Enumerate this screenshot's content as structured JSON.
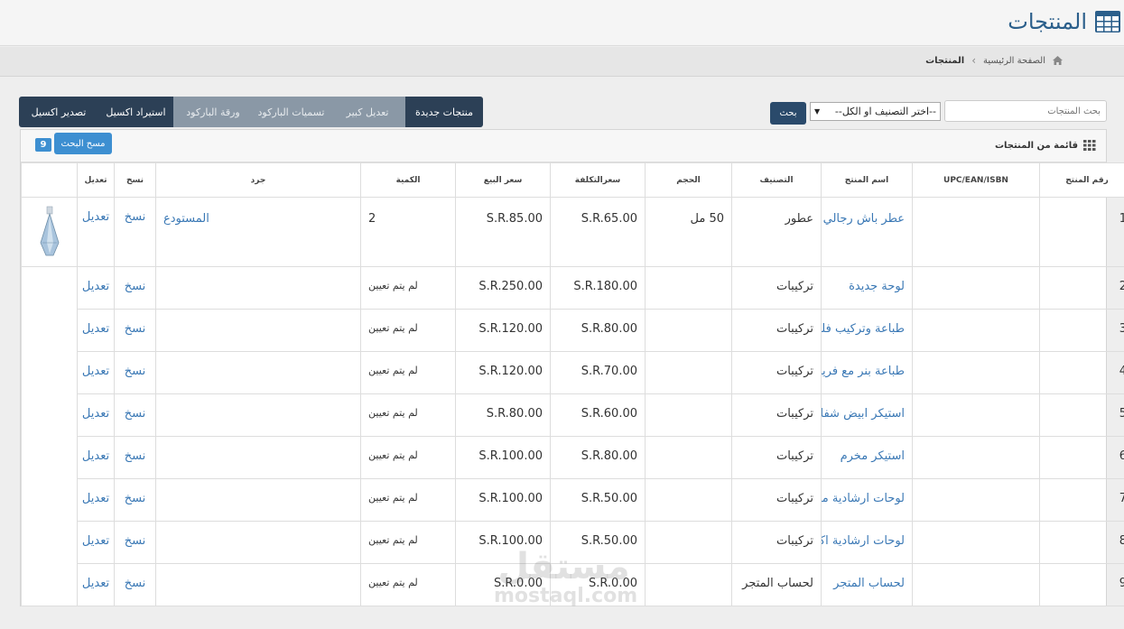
{
  "header": {
    "title": "المنتجات"
  },
  "breadcrumb": {
    "home": "الصفحة الرئيسية",
    "current": "المنتجات"
  },
  "search": {
    "placeholder": "بحث المنتجات",
    "category_selected": "--اختر التصنيف او الكل--",
    "button": "بحث"
  },
  "toolbar": {
    "new_products": "منتجات جديدة",
    "bulk_edit": "تعديل كبير",
    "barcode_labels": "تسميات الباركود",
    "barcode_sheet": "ورقة الباركود",
    "import_excel": "استيراد اكسيل",
    "export_excel": "تصدير اكسيل"
  },
  "panel": {
    "title": "قائمة من المنتجات",
    "clear_search": "مسح البحث",
    "count": "9"
  },
  "columns": {
    "number": "رقم المنتج",
    "upc": "UPC/EAN/ISBN",
    "name": "اسم المنتج",
    "category": "التصنيف",
    "size": "الحجم",
    "cost": "سعرالتكلفة",
    "price": "سعر البيع",
    "quantity": "الكمية",
    "inventory": "جرد",
    "copy": "نسخ",
    "edit": "تعديل"
  },
  "rows": [
    {
      "num": "1",
      "name": "عطر باش رجالي",
      "category": "عطور",
      "size": "50 مل",
      "cost": "S.R.65.00",
      "price": "S.R.85.00",
      "qty": "2",
      "inventory": "المستودع",
      "copy": "نسخ",
      "edit": "تعديل"
    },
    {
      "num": "2",
      "name": "لوحة جديدة",
      "category": "تركيبات",
      "size": "",
      "cost": "S.R.180.00",
      "price": "S.R.250.00",
      "qty": "لم يتم تعيين",
      "inventory": "",
      "copy": "نسخ",
      "edit": "تعديل"
    },
    {
      "num": "3",
      "name": "طباعة وتركيب فليكس",
      "category": "تركيبات",
      "size": "",
      "cost": "S.R.80.00",
      "price": "S.R.120.00",
      "qty": "لم يتم تعيين",
      "inventory": "",
      "copy": "نسخ",
      "edit": "تعديل"
    },
    {
      "num": "4",
      "name": "طباعة بنر مع فريم حديد",
      "category": "تركيبات",
      "size": "",
      "cost": "S.R.70.00",
      "price": "S.R.120.00",
      "qty": "لم يتم تعيين",
      "inventory": "",
      "copy": "نسخ",
      "edit": "تعديل"
    },
    {
      "num": "5",
      "name": "استيكر ابيض شفاف",
      "category": "تركيبات",
      "size": "",
      "cost": "S.R.60.00",
      "price": "S.R.80.00",
      "qty": "لم يتم تعيين",
      "inventory": "",
      "copy": "نسخ",
      "edit": "تعديل"
    },
    {
      "num": "6",
      "name": "استيكر مخرم",
      "category": "تركيبات",
      "size": "",
      "cost": "S.R.80.00",
      "price": "S.R.100.00",
      "qty": "لم يتم تعيين",
      "inventory": "",
      "copy": "نسخ",
      "edit": "تعديل"
    },
    {
      "num": "7",
      "name": "لوحات ارشادية مكتبية",
      "category": "تركيبات",
      "size": "",
      "cost": "S.R.50.00",
      "price": "S.R.100.00",
      "qty": "لم يتم تعيين",
      "inventory": "",
      "copy": "نسخ",
      "edit": "تعديل"
    },
    {
      "num": "8",
      "name": "لوحات ارشادية اكريليك",
      "category": "تركيبات",
      "size": "",
      "cost": "S.R.50.00",
      "price": "S.R.100.00",
      "qty": "لم يتم تعيين",
      "inventory": "",
      "copy": "نسخ",
      "edit": "تعديل"
    },
    {
      "num": "9",
      "name": "لحساب المتجر",
      "category": "لحساب المتجر",
      "size": "",
      "cost": "S.R.0.00",
      "price": "S.R.0.00",
      "qty": "لم يتم تعيين",
      "inventory": "",
      "copy": "نسخ",
      "edit": "تعديل"
    }
  ],
  "watermark": {
    "arabic": "مستقل",
    "latin": "mostaql.com"
  },
  "colors": {
    "accent_blue": "#3d8fd1",
    "dark_button": "#2c4056",
    "link": "#3a78b5",
    "title": "#2b5f8b"
  }
}
